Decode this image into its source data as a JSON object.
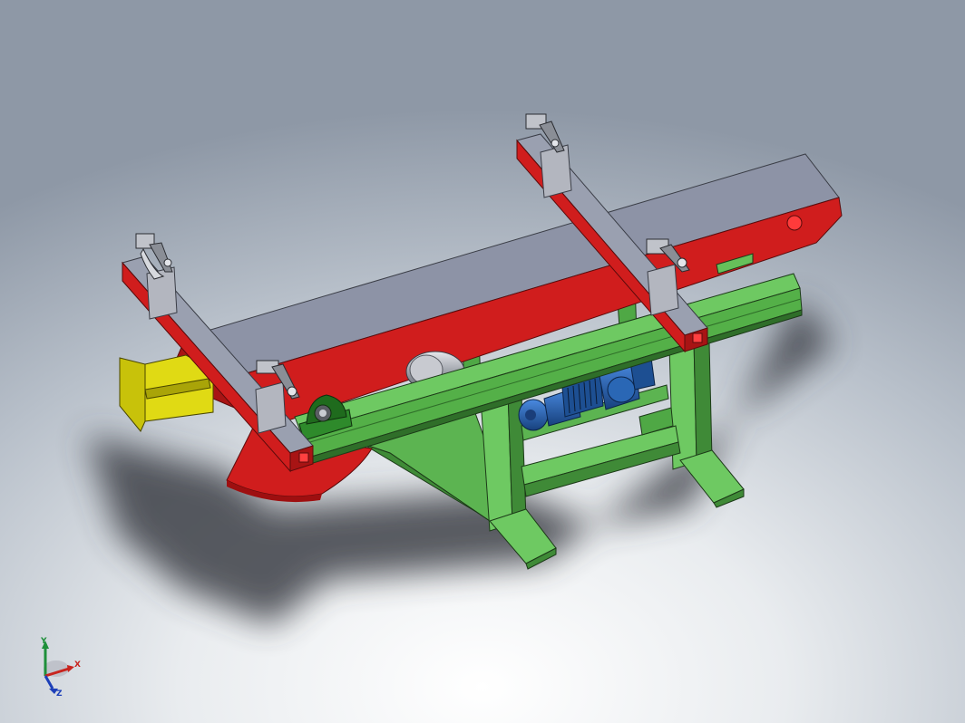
{
  "viewport": {
    "model": "tilting-conveyor-frame-assembly"
  },
  "colors": {
    "beam_top": "#8d93a6",
    "beam_side": "#d01d1d",
    "beam_dark": "#9e0f10",
    "stand_green": "#66c05a",
    "stand_green_dark": "#3d8e36",
    "motor_blue": "#2a67b5",
    "rail_yellow": "#d6d00a",
    "bracket_grey": "#b3b6bf",
    "shadow": "#4a4f57"
  },
  "icons": {
    "triad": "coordinate-triad-icon",
    "bearing": "pillow-block-bearing-icon",
    "motor": "gear-motor-icon",
    "clamp": "toggle-clamp-icon"
  },
  "triad": {
    "x_label": "X",
    "y_label": "Y",
    "z_label": "Z"
  }
}
